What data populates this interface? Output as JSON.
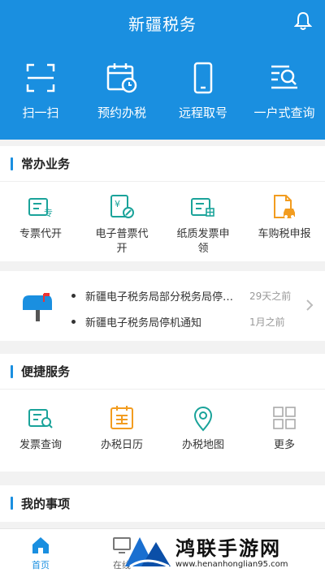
{
  "header": {
    "title": "新疆税务",
    "bell_icon": "bell-icon"
  },
  "top_actions": [
    {
      "label": "扫一扫",
      "icon": "scan-icon"
    },
    {
      "label": "预约办税",
      "icon": "calendar-clock-icon"
    },
    {
      "label": "远程取号",
      "icon": "phone-icon"
    },
    {
      "label": "一户式查询",
      "icon": "search-list-icon"
    }
  ],
  "common": {
    "title": "常办业务",
    "items": [
      {
        "label": "专票代开",
        "icon": "special-invoice-icon"
      },
      {
        "label": "电子普票代开",
        "icon": "e-invoice-icon"
      },
      {
        "label": "纸质发票申领",
        "icon": "paper-invoice-icon"
      },
      {
        "label": "车购税申报",
        "icon": "vehicle-tax-icon"
      }
    ]
  },
  "notices": [
    {
      "text": "新疆电子税务局部分税务局停机通知",
      "time": "29天之前"
    },
    {
      "text": "新疆电子税务局停机通知",
      "time": "1月之前"
    }
  ],
  "quick": {
    "title": "便捷服务",
    "items": [
      {
        "label": "发票查询",
        "icon": "invoice-search-icon"
      },
      {
        "label": "办税日历",
        "icon": "tax-calendar-icon"
      },
      {
        "label": "办税地图",
        "icon": "map-pin-icon"
      },
      {
        "label": "更多",
        "icon": "grid-more-icon"
      }
    ]
  },
  "mine": {
    "title": "我的事项"
  },
  "tabbar": [
    {
      "label": "首页",
      "active": true
    },
    {
      "label": "在线"
    }
  ],
  "watermark": {
    "text": "鸿联手游网",
    "url": "www.henanhonglian95.com"
  },
  "colors": {
    "primary": "#1a8fe0",
    "teal": "#1aa39a",
    "orange": "#f29c1f"
  }
}
